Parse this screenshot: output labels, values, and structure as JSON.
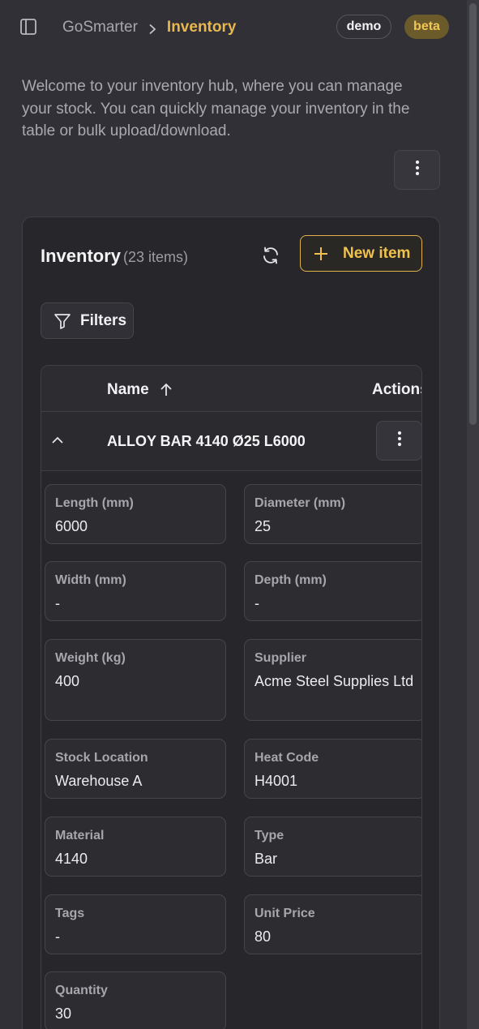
{
  "header": {
    "breadcrumb_root": "GoSmarter",
    "breadcrumb_current": "Inventory",
    "badges": [
      "demo",
      "beta"
    ],
    "accent": "#e8b74f"
  },
  "intro": {
    "text": "Welcome to your inventory hub, where you can manage your stock. You can quickly manage your inventory in the table or bulk upload/download."
  },
  "inventory": {
    "title": "Inventory",
    "count": "(23 items)",
    "new_item_label": "New item",
    "filters_label": "Filters",
    "columns": {
      "name": "Name",
      "actions": "Actions"
    },
    "rows": [
      {
        "name": "ALLOY BAR 4140 Ø25 L6000",
        "expanded": true,
        "details": [
          {
            "label": "Length (mm)",
            "value": "6000"
          },
          {
            "label": "Diameter (mm)",
            "value": "25"
          },
          {
            "label": "Width (mm)",
            "value": "-"
          },
          {
            "label": "Depth (mm)",
            "value": "-"
          },
          {
            "label": "Weight (kg)",
            "value": "400"
          },
          {
            "label": "Supplier",
            "value": "Acme Steel Supplies Ltd"
          },
          {
            "label": "Stock Location",
            "value": "Warehouse A"
          },
          {
            "label": "Heat Code",
            "value": "H4001"
          },
          {
            "label": "Material",
            "value": "4140"
          },
          {
            "label": "Type",
            "value": "Bar"
          },
          {
            "label": "Tags",
            "value": "-"
          },
          {
            "label": "Unit Price",
            "value": "80"
          },
          {
            "label": "Quantity",
            "value": "30"
          }
        ]
      }
    ]
  },
  "icons": {
    "sidebar_toggle": "sidebar-toggle-icon",
    "breadcrumb_separator": "chevron-right-icon",
    "page_menu": "more-vertical-icon",
    "refresh": "refresh-icon",
    "new_item": "plus-icon",
    "filters": "filter-icon",
    "sort": "arrow-up-icon",
    "row_toggle": "chevron-up-icon",
    "row_menu": "more-vertical-icon"
  }
}
